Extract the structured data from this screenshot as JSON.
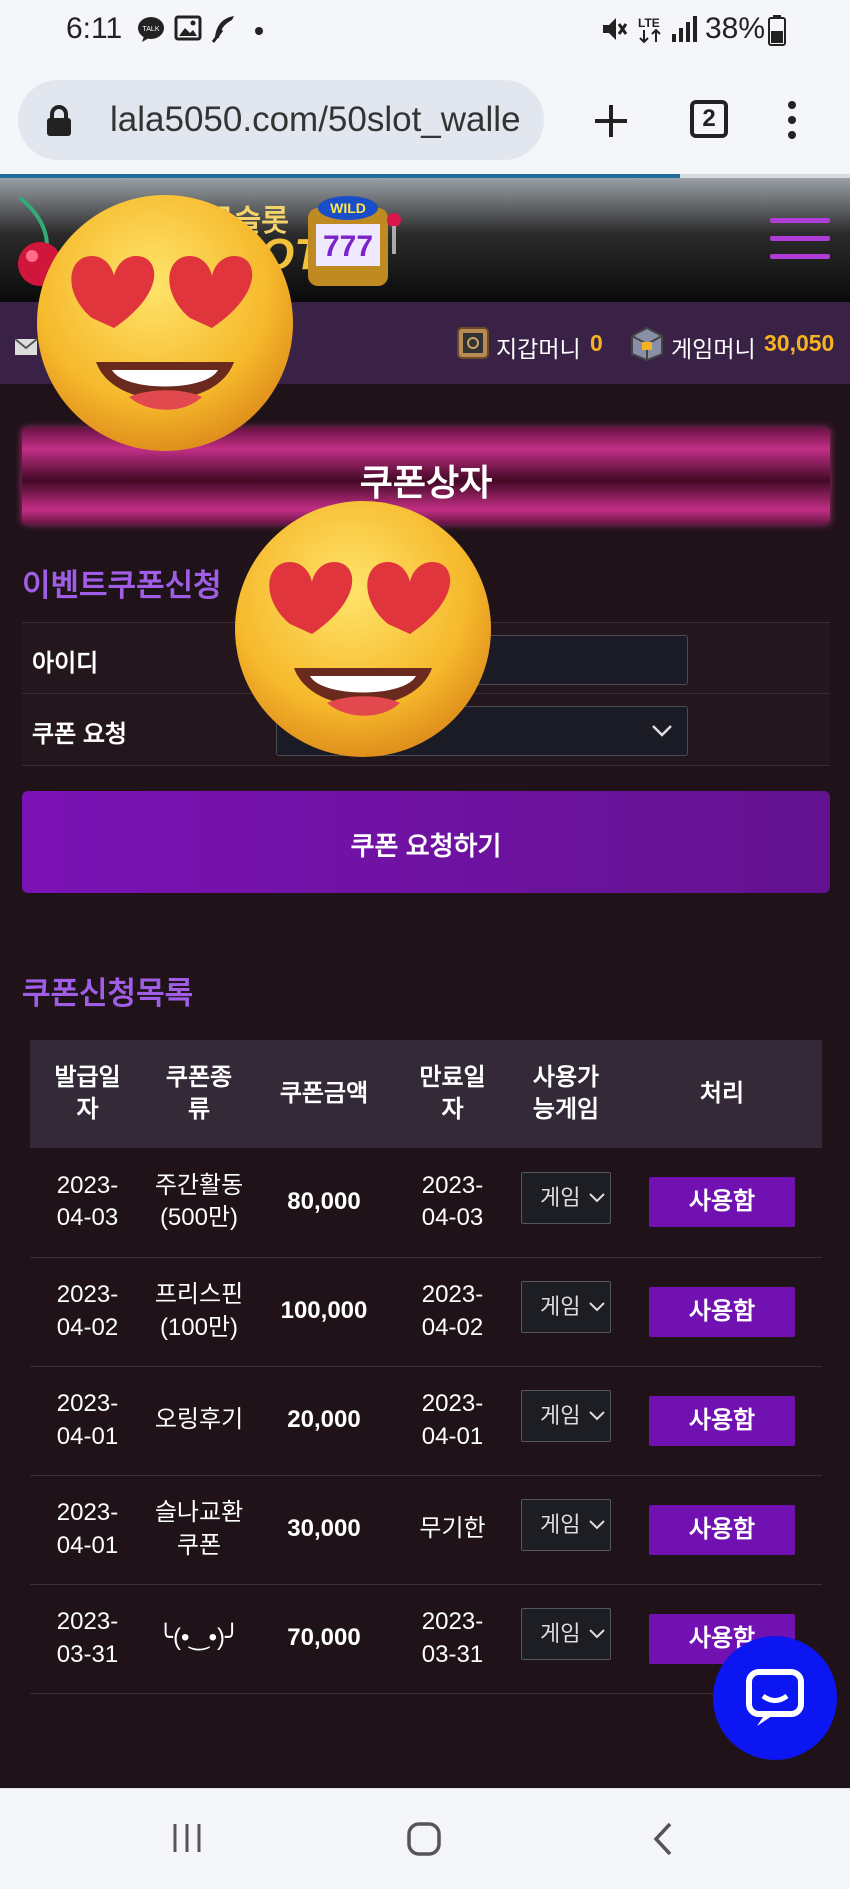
{
  "status_bar": {
    "time": "6:11",
    "battery": "38%",
    "icons": [
      "talk-icon",
      "gallery-icon",
      "feather-icon",
      "dot-icon",
      "mute-icon",
      "lte-icon",
      "signal-icon",
      "battery-icon"
    ]
  },
  "browser": {
    "url": "lala5050.com/50slot_walle",
    "tab_count": "2",
    "icons": [
      "lock-icon",
      "new-tab-icon",
      "tabs-icon",
      "menu-dots-icon"
    ]
  },
  "header": {
    "logo_text_top": "골슬롯",
    "logo_text_main": "OT",
    "logo_badge": "WILD",
    "logo_reels": "777"
  },
  "money_bar": {
    "wallet_label": "지갑머니",
    "wallet_value": "0",
    "game_label": "게임머니",
    "game_value": "30,050"
  },
  "coupon_box": {
    "title": "쿠폰상자"
  },
  "event_section": {
    "title": "이벤트쿠폰신청",
    "id_label": "아이디",
    "request_label": "쿠폰 요청",
    "submit_label": "쿠폰 요청하기"
  },
  "list_section": {
    "title": "쿠폰신청목록",
    "columns": [
      "발급일\n자",
      "쿠폰종\n류",
      "쿠폰금액",
      "만료일\n자",
      "사용가\n능게임",
      "처리"
    ],
    "rows": [
      {
        "issued": "2023-\n04-03",
        "type": "주간활동\n(500만)",
        "amount": "80,000",
        "expiry": "2023-\n04-03",
        "game": "게임",
        "action": "사용함"
      },
      {
        "issued": "2023-\n04-02",
        "type": "프리스핀\n(100만)",
        "amount": "100,000",
        "expiry": "2023-\n04-02",
        "game": "게임",
        "action": "사용함"
      },
      {
        "issued": "2023-\n04-01",
        "type": "오링후기",
        "amount": "20,000",
        "expiry": "2023-\n04-01",
        "game": "게임",
        "action": "사용함"
      },
      {
        "issued": "2023-\n04-01",
        "type": "슬나교환\n쿠폰",
        "amount": "30,000",
        "expiry": "무기한",
        "game": "게임",
        "action": "사용함"
      },
      {
        "issued": "2023-\n03-31",
        "type": "╰(•‿•)╯",
        "amount": "70,000",
        "expiry": "2023-\n03-31",
        "game": "게임",
        "action": "사용함"
      }
    ]
  },
  "colors": {
    "accent_purple": "#7111b2",
    "amount_gold": "#f5b323",
    "section_title": "#a05ee6",
    "chat_blue": "#0b16f2"
  },
  "navbar_icons": [
    "recent-apps-icon",
    "home-icon",
    "back-icon"
  ]
}
